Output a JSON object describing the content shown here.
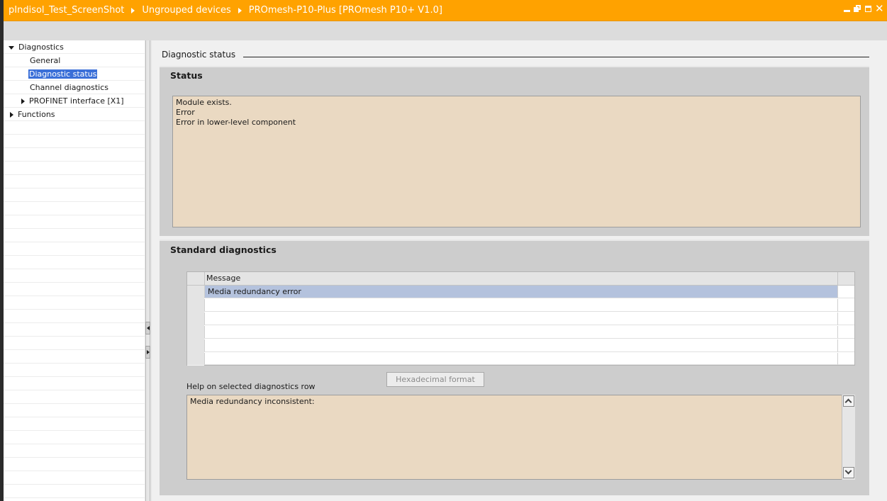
{
  "titlebar": {
    "breadcrumb": [
      "pIndisol_Test_ScreenShot",
      "Ungrouped devices",
      "PROmesh-P10-Plus [PROmesh P10+ V1.0]"
    ],
    "background_color": "#ffa200"
  },
  "nav": {
    "items": [
      {
        "label": "Diagnostics",
        "expander": "expanded"
      },
      {
        "label": "General"
      },
      {
        "label": "Diagnostic status",
        "selected": true
      },
      {
        "label": "Channel diagnostics"
      },
      {
        "label": "PROFINET interface [X1]",
        "expander": "collapsed"
      },
      {
        "label": "Functions",
        "expander": "collapsed"
      }
    ]
  },
  "section": {
    "title": "Diagnostic status"
  },
  "status_group": {
    "title": "Status",
    "lines": [
      "Module exists.",
      "Error",
      "Error in lower-level component"
    ]
  },
  "std_diag_group": {
    "title": "Standard diagnostics",
    "table": {
      "column": "Message",
      "rows": [
        "Media redundancy error",
        "",
        "",
        "",
        "",
        ""
      ]
    },
    "hex_button": "Hexadecimal format",
    "help_label": "Help on selected diagnostics row",
    "help_text": "Media redundancy inconsistent:"
  },
  "colors": {
    "selection": "#3a6fd8",
    "row_selected": "#b4c2dd",
    "textbox_bg": "#ead9c2"
  }
}
